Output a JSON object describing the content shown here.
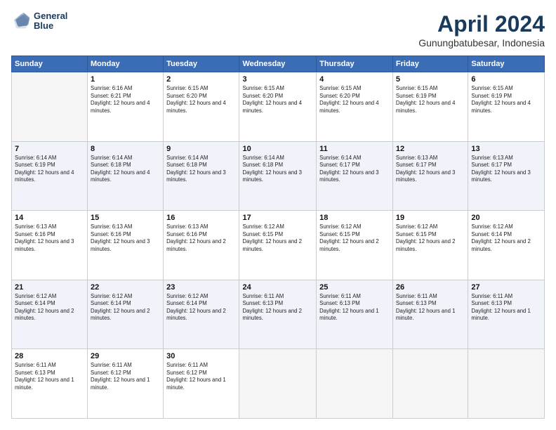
{
  "logo": {
    "line1": "General",
    "line2": "Blue"
  },
  "title": "April 2024",
  "subtitle": "Gunungbatubesar, Indonesia",
  "weekdays": [
    "Sunday",
    "Monday",
    "Tuesday",
    "Wednesday",
    "Thursday",
    "Friday",
    "Saturday"
  ],
  "weeks": [
    [
      {
        "day": null
      },
      {
        "day": "1",
        "rise": "6:16 AM",
        "set": "6:21 PM",
        "daylight": "12 hours and 4 minutes."
      },
      {
        "day": "2",
        "rise": "6:15 AM",
        "set": "6:20 PM",
        "daylight": "12 hours and 4 minutes."
      },
      {
        "day": "3",
        "rise": "6:15 AM",
        "set": "6:20 PM",
        "daylight": "12 hours and 4 minutes."
      },
      {
        "day": "4",
        "rise": "6:15 AM",
        "set": "6:20 PM",
        "daylight": "12 hours and 4 minutes."
      },
      {
        "day": "5",
        "rise": "6:15 AM",
        "set": "6:19 PM",
        "daylight": "12 hours and 4 minutes."
      },
      {
        "day": "6",
        "rise": "6:15 AM",
        "set": "6:19 PM",
        "daylight": "12 hours and 4 minutes."
      }
    ],
    [
      {
        "day": "7",
        "rise": "6:14 AM",
        "set": "6:19 PM",
        "daylight": "12 hours and 4 minutes."
      },
      {
        "day": "8",
        "rise": "6:14 AM",
        "set": "6:18 PM",
        "daylight": "12 hours and 4 minutes."
      },
      {
        "day": "9",
        "rise": "6:14 AM",
        "set": "6:18 PM",
        "daylight": "12 hours and 3 minutes."
      },
      {
        "day": "10",
        "rise": "6:14 AM",
        "set": "6:18 PM",
        "daylight": "12 hours and 3 minutes."
      },
      {
        "day": "11",
        "rise": "6:14 AM",
        "set": "6:17 PM",
        "daylight": "12 hours and 3 minutes."
      },
      {
        "day": "12",
        "rise": "6:13 AM",
        "set": "6:17 PM",
        "daylight": "12 hours and 3 minutes."
      },
      {
        "day": "13",
        "rise": "6:13 AM",
        "set": "6:17 PM",
        "daylight": "12 hours and 3 minutes."
      }
    ],
    [
      {
        "day": "14",
        "rise": "6:13 AM",
        "set": "6:16 PM",
        "daylight": "12 hours and 3 minutes."
      },
      {
        "day": "15",
        "rise": "6:13 AM",
        "set": "6:16 PM",
        "daylight": "12 hours and 3 minutes."
      },
      {
        "day": "16",
        "rise": "6:13 AM",
        "set": "6:16 PM",
        "daylight": "12 hours and 2 minutes."
      },
      {
        "day": "17",
        "rise": "6:12 AM",
        "set": "6:15 PM",
        "daylight": "12 hours and 2 minutes."
      },
      {
        "day": "18",
        "rise": "6:12 AM",
        "set": "6:15 PM",
        "daylight": "12 hours and 2 minutes."
      },
      {
        "day": "19",
        "rise": "6:12 AM",
        "set": "6:15 PM",
        "daylight": "12 hours and 2 minutes."
      },
      {
        "day": "20",
        "rise": "6:12 AM",
        "set": "6:14 PM",
        "daylight": "12 hours and 2 minutes."
      }
    ],
    [
      {
        "day": "21",
        "rise": "6:12 AM",
        "set": "6:14 PM",
        "daylight": "12 hours and 2 minutes."
      },
      {
        "day": "22",
        "rise": "6:12 AM",
        "set": "6:14 PM",
        "daylight": "12 hours and 2 minutes."
      },
      {
        "day": "23",
        "rise": "6:12 AM",
        "set": "6:14 PM",
        "daylight": "12 hours and 2 minutes."
      },
      {
        "day": "24",
        "rise": "6:11 AM",
        "set": "6:13 PM",
        "daylight": "12 hours and 2 minutes."
      },
      {
        "day": "25",
        "rise": "6:11 AM",
        "set": "6:13 PM",
        "daylight": "12 hours and 1 minute."
      },
      {
        "day": "26",
        "rise": "6:11 AM",
        "set": "6:13 PM",
        "daylight": "12 hours and 1 minute."
      },
      {
        "day": "27",
        "rise": "6:11 AM",
        "set": "6:13 PM",
        "daylight": "12 hours and 1 minute."
      }
    ],
    [
      {
        "day": "28",
        "rise": "6:11 AM",
        "set": "6:13 PM",
        "daylight": "12 hours and 1 minute."
      },
      {
        "day": "29",
        "rise": "6:11 AM",
        "set": "6:12 PM",
        "daylight": "12 hours and 1 minute."
      },
      {
        "day": "30",
        "rise": "6:11 AM",
        "set": "6:12 PM",
        "daylight": "12 hours and 1 minute."
      },
      {
        "day": null
      },
      {
        "day": null
      },
      {
        "day": null
      },
      {
        "day": null
      }
    ]
  ]
}
